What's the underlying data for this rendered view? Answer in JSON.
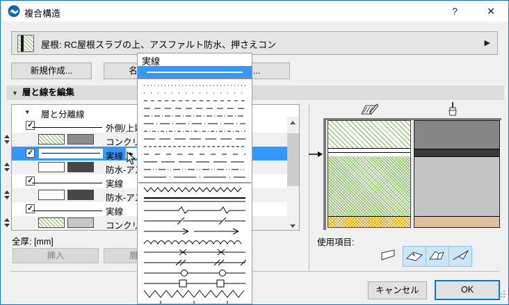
{
  "window": {
    "title": "複合構造",
    "help_label": "?",
    "close_label": "✕"
  },
  "banner": {
    "text": "屋根: RC屋根スラブの上、アスファルト防水、押さえコン",
    "arrow": "▶"
  },
  "toolbar": {
    "new_label": "新規作成...",
    "rename_label": "名前変更...",
    "delete_label": "削除..."
  },
  "section": {
    "collapse_arrow": "▼",
    "title": "層と線を編集"
  },
  "layer_table": {
    "rows": [
      {
        "type": "header",
        "label": "層と分離線"
      },
      {
        "type": "line",
        "checked": true,
        "label": "外側/上端:..."
      },
      {
        "type": "material",
        "fill": "hatch",
        "surface": "#8d8d8d",
        "label": "コンクリート-..."
      },
      {
        "type": "line",
        "checked": true,
        "label": "実線",
        "selected": true
      },
      {
        "type": "material",
        "fill": "plain",
        "surface": "#474747",
        "label": "防水-アスフ..."
      },
      {
        "type": "line",
        "checked": true,
        "label": "実線"
      },
      {
        "type": "material",
        "fill": "plain",
        "surface": "#474747",
        "label": "防水-アスフ..."
      },
      {
        "type": "line",
        "checked": true,
        "label": "実線"
      },
      {
        "type": "material",
        "fill": "hatch",
        "surface": "#c6c6c6",
        "label": "コンクリート..."
      }
    ]
  },
  "footer_left": {
    "total_label": "全厚: [mm]",
    "insert_label": "挿入",
    "delete_layer_label": "層を削除"
  },
  "linetype_popup": {
    "current_name": "実線",
    "current_pattern": "solid",
    "items": [
      {
        "group": "dash",
        "pattern": "dots-fine"
      },
      {
        "group": "dash",
        "pattern": "dots-sparse"
      },
      {
        "group": "dash",
        "pattern": "dash-short"
      },
      {
        "group": "dash",
        "pattern": "dash-med"
      },
      {
        "group": "dash",
        "pattern": "dashdot"
      },
      {
        "group": "dash",
        "pattern": "dashdot-long"
      },
      {
        "group": "dash",
        "pattern": "dashdot-2"
      },
      {
        "group": "dash",
        "pattern": "dash-long"
      },
      {
        "group": "dash",
        "pattern": "dash-dense"
      },
      {
        "group": "dash",
        "pattern": "dash-spaced"
      },
      {
        "group": "dash",
        "pattern": "dash-xlong"
      },
      {
        "group": "dash",
        "pattern": "dashdotdot"
      },
      {
        "group": "dash",
        "pattern": "longdash-dot"
      },
      {
        "separator": true
      },
      {
        "group": "special",
        "pattern": "zigzag-small"
      },
      {
        "group": "special",
        "pattern": "double-line"
      },
      {
        "group": "special",
        "pattern": "break-zigzag"
      },
      {
        "group": "special",
        "pattern": "break-slash"
      },
      {
        "group": "special",
        "pattern": "arrows"
      },
      {
        "group": "special",
        "pattern": "wave"
      },
      {
        "group": "special",
        "pattern": "x-marks"
      },
      {
        "group": "special",
        "pattern": "double-slash"
      },
      {
        "group": "special",
        "pattern": "circles"
      },
      {
        "group": "special",
        "pattern": "squares"
      },
      {
        "group": "special",
        "pattern": "zigzag-large"
      },
      {
        "group": "special",
        "pattern": "plus-marks"
      }
    ]
  },
  "preview_panel": {
    "usage_label": "使用項目:",
    "usage": [
      {
        "name": "wall",
        "active": false
      },
      {
        "name": "slab",
        "active": true
      },
      {
        "name": "roof",
        "active": true
      },
      {
        "name": "shell",
        "active": true
      }
    ]
  },
  "dialog_buttons": {
    "cancel_label": "キャンセル",
    "ok_label": "OK"
  },
  "colors": {
    "selection_blue": "#3399ff",
    "window_border": "#0078d7",
    "hatch_green": "#79b450",
    "surface_dark": "#868686",
    "surface_band": "#3a3a3a",
    "surface_light": "#c4c4c4",
    "surface_tan": "#dfc09e",
    "insulation_yellow": "#d9a50f",
    "usage_active_bg": "#cde6f7"
  }
}
